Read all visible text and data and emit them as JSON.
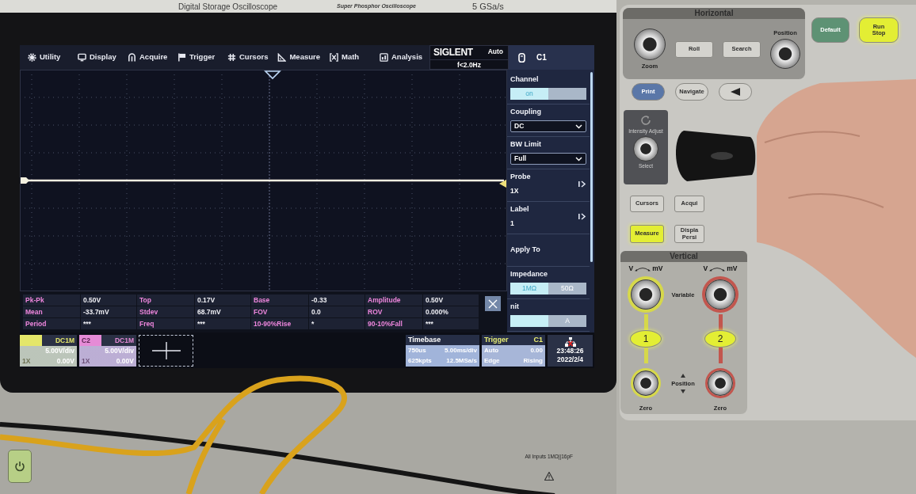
{
  "header": {
    "model": "Digital Storage Oscilloscope",
    "series": "Super Phosphor Oscilloscope",
    "sample_rate": "5 GSa/s"
  },
  "screen": {
    "menu_bar": [
      {
        "kind": "utility",
        "label": "Utility"
      },
      {
        "kind": "display",
        "label": "Display"
      },
      {
        "kind": "acquire",
        "label": "Acquire"
      },
      {
        "kind": "trigger",
        "label": "Trigger"
      },
      {
        "kind": "cursors",
        "label": "Cursors"
      },
      {
        "kind": "measure",
        "label": "Measure"
      },
      {
        "kind": "math",
        "label": "Math"
      },
      {
        "kind": "analysis",
        "label": "Analysis"
      }
    ],
    "status_badge": {
      "brand": "SIGLENT",
      "run_mode": "Auto",
      "frequency": "f<2.0Hz"
    },
    "side_menu": {
      "title": "C1",
      "items": [
        {
          "kind": "toggle",
          "label": "Channel",
          "options": [
            {
              "label": "on",
              "selected": true
            },
            {
              "selected": false
            }
          ]
        },
        {
          "kind": "select",
          "label": "Coupling",
          "value": "DC"
        },
        {
          "kind": "select",
          "label": "BW Limit",
          "value": "Full"
        },
        {
          "kind": "submenu",
          "label": "Probe",
          "value": "1X"
        },
        {
          "kind": "submenu",
          "label": "Label",
          "value": "1"
        },
        {
          "kind": "action",
          "label": "Apply To"
        },
        {
          "kind": "toggle",
          "label": "Impedance",
          "options": [
            {
              "label": "1MΩ",
              "selected": true
            },
            {
              "label": "50Ω",
              "selected": false
            }
          ]
        },
        {
          "kind": "toggle",
          "label": "nit",
          "options": [
            {
              "selected": true
            },
            {
              "label": "A",
              "selected": false
            }
          ]
        }
      ]
    },
    "measurements": [
      {
        "label": "Pk-Pk",
        "value": "0.50V"
      },
      {
        "label": "Top",
        "value": "0.17V"
      },
      {
        "label": "Base",
        "value": "-0.33"
      },
      {
        "label": "Amplitude",
        "value": "0.50V"
      },
      {
        "label": "Mean",
        "value": "-33.7mV"
      },
      {
        "label": "Stdev",
        "value": "68.7mV"
      },
      {
        "label": "FOV",
        "value": "0.0"
      },
      {
        "label": "ROV",
        "value": "0.000%"
      },
      {
        "label": "Period",
        "value": "***"
      },
      {
        "label": "Freq",
        "value": "***"
      },
      {
        "label": "10-90%Rise",
        "value": "*"
      },
      {
        "label": "90-10%Fall",
        "value": "***"
      }
    ],
    "channels": [
      {
        "coupling": "DC1M",
        "scale": "5.00V/div",
        "probe": "1X",
        "offset": "0.00V",
        "color": "#e4e66a"
      },
      {
        "name": "C2",
        "coupling": "DC1M",
        "scale": "5.00V/div",
        "probe": "1X",
        "offset": "0.00V",
        "color": "#e58bd6"
      }
    ],
    "timebase": {
      "title": "Timebase",
      "delay": "750us",
      "scale": "5.00ms/div",
      "memory_depth": "625kpts",
      "sample_rate": "12.5MSa/s"
    },
    "trigger": {
      "title": "Trigger",
      "source": "C1",
      "mode": "Auto",
      "level": "0.00",
      "type": "Edge",
      "slope": "Rising"
    },
    "clock": {
      "time": "23:48:26",
      "date": "2022/2/4"
    }
  },
  "front_panel": {
    "horizontal": {
      "title": "Horizontal",
      "zoom_label": "Zoom",
      "position_label": "Position",
      "buttons": [
        {
          "label": "Roll",
          "lit": false
        },
        {
          "label": "Search",
          "lit": false
        }
      ]
    },
    "main_buttons": [
      {
        "label": "Default",
        "color": "#5e9274"
      },
      {
        "label": "Run\nStop",
        "lit": true
      }
    ],
    "nav_buttons": [
      {
        "kind": "text",
        "label": "Print",
        "color": "#5a77a8"
      },
      {
        "kind": "text",
        "label": "Navigate",
        "lit": false
      },
      {
        "kind": "back",
        "lit": false
      }
    ],
    "intensity": {
      "title": "Intensity Adjust",
      "select_label": "Select"
    },
    "function_buttons": [
      {
        "label": "Cursors",
        "lit": false
      },
      {
        "label": "Acqui",
        "lit": false
      },
      {
        "label": "Measure",
        "lit": true
      },
      {
        "label": "Displa\nPersi",
        "lit": false
      }
    ],
    "vertical": {
      "title": "Vertical",
      "variable_label": "Variable",
      "position_label": "Position",
      "channels": [
        {
          "label": "1",
          "lit": true,
          "color": "#d6d84a",
          "coarse_label": "V",
          "fine_label": "mV",
          "zero_label": "Zero"
        },
        {
          "label": "2",
          "lit": true,
          "color": "#c2564e",
          "coarse_label": "V",
          "fine_label": "mV",
          "zero_label": "Zero"
        }
      ]
    }
  },
  "lower_panel": {
    "inputs_note": "All Inputs 1MΩ||16pF"
  }
}
